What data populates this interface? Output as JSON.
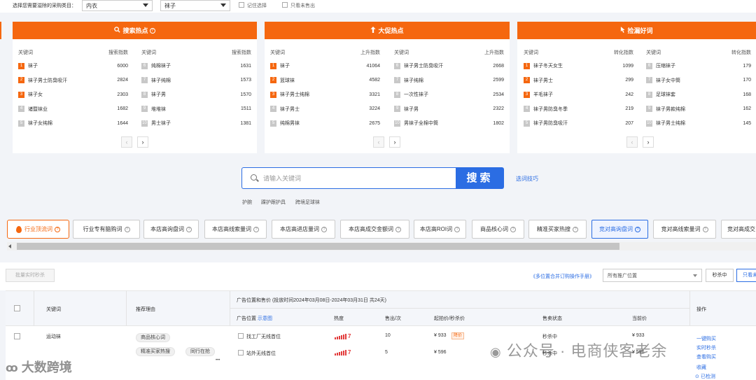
{
  "filter": {
    "label": "选择您需要溢除的采购类目：",
    "category1": "内衣",
    "category2": "袜子",
    "remember": "记住选择",
    "unsold_only": "只看未售出"
  },
  "panels": [
    {
      "title": "搜索热点",
      "icon": "search-icon",
      "columns": [
        {
          "header_kw": "关键词",
          "header_metric": "搜索指数",
          "rows": [
            {
              "rank": "1",
              "kw": "袜子",
              "num": "6000"
            },
            {
              "rank": "2",
              "kw": "袜子男士防臭吸汗",
              "num": "2824"
            },
            {
              "rank": "3",
              "kw": "袜子女",
              "num": "2303"
            },
            {
              "rank": "4",
              "kw": "诸暨袜业",
              "num": "1682"
            },
            {
              "rank": "5",
              "kw": "袜子女纯棉",
              "num": "1644"
            }
          ]
        },
        {
          "header_kw": "关键词",
          "header_metric": "搜索指数",
          "rows": [
            {
              "rank": "6",
              "kw": "纯棉袜子",
              "num": "1631"
            },
            {
              "rank": "7",
              "kw": "袜子纯棉",
              "num": "1573"
            },
            {
              "rank": "8",
              "kw": "袜子男",
              "num": "1570"
            },
            {
              "rank": "9",
              "kw": "堆堆袜",
              "num": "1511"
            },
            {
              "rank": "10",
              "kw": "男士袜子",
              "num": "1381"
            }
          ]
        }
      ]
    },
    {
      "title": "大促热点",
      "icon": "arrow-up-icon",
      "columns": [
        {
          "header_kw": "关键词",
          "header_metric": "上升指数",
          "rows": [
            {
              "rank": "1",
              "kw": "袜子",
              "num": "41064"
            },
            {
              "rank": "2",
              "kw": "篮球袜",
              "num": "4582"
            },
            {
              "rank": "3",
              "kw": "袜子男士纯棉",
              "num": "3321"
            },
            {
              "rank": "4",
              "kw": "袜子男士",
              "num": "3224"
            },
            {
              "rank": "5",
              "kw": "纯棉男袜",
              "num": "2675"
            }
          ]
        },
        {
          "header_kw": "关键词",
          "header_metric": "上升指数",
          "rows": [
            {
              "rank": "6",
              "kw": "袜子男士防臭吸汗",
              "num": "2668"
            },
            {
              "rank": "7",
              "kw": "袜子纯棉",
              "num": "2599"
            },
            {
              "rank": "8",
              "kw": "一次性袜子",
              "num": "2534"
            },
            {
              "rank": "9",
              "kw": "袜子男",
              "num": "2322"
            },
            {
              "rank": "10",
              "kw": "男袜子全棉中筒",
              "num": "1802"
            }
          ]
        }
      ]
    },
    {
      "title": "捡漏好词",
      "icon": "cursor-icon",
      "columns": [
        {
          "header_kw": "关键词",
          "header_metric": "转化指数",
          "rows": [
            {
              "rank": "1",
              "kw": "袜子冬天女生",
              "num": "1099"
            },
            {
              "rank": "2",
              "kw": "袜子男士",
              "num": "299"
            },
            {
              "rank": "3",
              "kw": "羊毛袜子",
              "num": "242"
            },
            {
              "rank": "4",
              "kw": "袜子男防臭冬季",
              "num": "219"
            },
            {
              "rank": "5",
              "kw": "袜子男防臭吸汗",
              "num": "207"
            }
          ]
        },
        {
          "header_kw": "关键词",
          "header_metric": "转化指数",
          "rows": [
            {
              "rank": "6",
              "kw": "压缩袜子",
              "num": "179"
            },
            {
              "rank": "7",
              "kw": "袜子女中筒",
              "num": "170"
            },
            {
              "rank": "8",
              "kw": "足球袜套",
              "num": "168"
            },
            {
              "rank": "9",
              "kw": "袜子男款纯棉",
              "num": "162"
            },
            {
              "rank": "10",
              "kw": "袜子男士纯棉",
              "num": "145"
            }
          ]
        }
      ]
    }
  ],
  "search": {
    "placeholder": "请输入关键词",
    "button": "搜索",
    "tips": "选词技巧",
    "suggestions": [
      "护腕",
      "踝护跟护具",
      "跨境足球袜"
    ]
  },
  "tabs": [
    "行业顶流词",
    "行业专有脑购词",
    "本店高询盘词",
    "本店高线索量词",
    "本店高进店量词",
    "本店高成交金额词",
    "本店高ROI词",
    "商品核心词",
    "精准买家热搜",
    "竞对高询盘词",
    "竞对高线索量词",
    "竞对高成交"
  ],
  "toolbar": {
    "batch": "批量实时秒杀",
    "guide": "《多位置合并订购操作手册》",
    "position_select": "所有推广位置",
    "status": "秒杀中",
    "more": "只看未"
  },
  "table": {
    "headers": {
      "keyword": "关键词",
      "reason": "推荐理由",
      "group": "广告位置和售价",
      "period": "(投放时间2024年03月08日-2024年03月31日 共24天)",
      "position": "广告位置",
      "diagram": "示意图",
      "heat": "热度",
      "sold": "售出/次",
      "price": "起拍价/秒杀价",
      "sale_status": "售卖状态",
      "current": "当前价",
      "actions": "操作"
    },
    "rows": [
      {
        "keyword": "运动袜",
        "tags": [
          "商品核心词",
          "精准买家热搜",
          "同行在抢"
        ],
        "more": "•••",
        "slots": [
          {
            "position": "找工厂无线首位",
            "heat": "7",
            "sold": "10",
            "price": "¥ 933",
            "badge": "降价",
            "status": "秒杀中",
            "current": "¥ 933"
          },
          {
            "position": "站外无线首位",
            "heat": "7",
            "sold": "5",
            "price": "¥ 596",
            "badge": "",
            "status": "秒杀中",
            "current": "¥ 596"
          }
        ],
        "actions": [
          "一键购买",
          "实时秒杀",
          "查看购买",
          "收藏",
          "已检测"
        ]
      }
    ]
  },
  "watermark": {
    "left": "大数跨境",
    "right": "公众号 · 电商侠客老余"
  }
}
